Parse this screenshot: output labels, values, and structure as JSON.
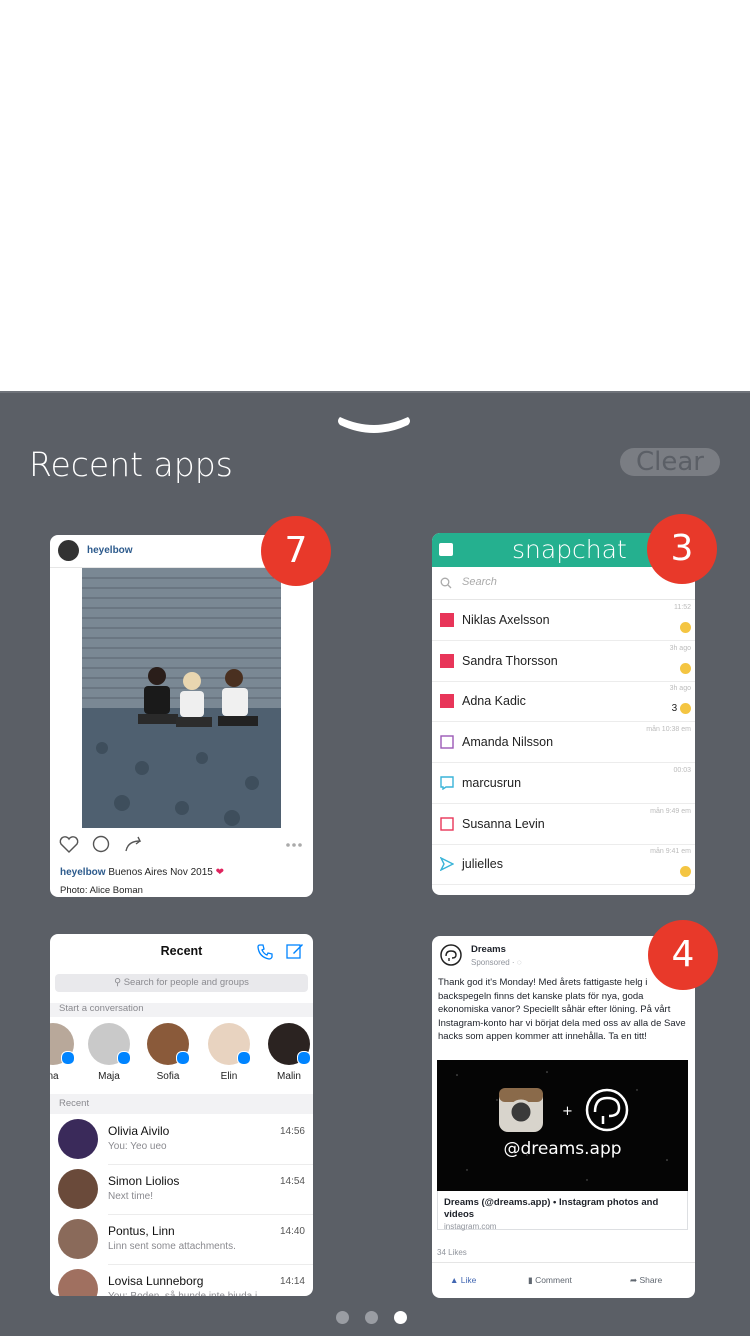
{
  "panel": {
    "title": "Recent apps",
    "clear_label": "Clear"
  },
  "instagram": {
    "badge": "7",
    "username": "heyelbow",
    "caption_user": "heyelbow",
    "caption_text": "Buenos Aires Nov 2015",
    "photo_credit": "Photo: Alice Boman"
  },
  "snapchat": {
    "badge": "3",
    "title": "snapchat",
    "search_placeholder": "Search",
    "rows": [
      {
        "name": "Niklas Axelsson",
        "time": "11:52",
        "extra": "",
        "color": "#e83559",
        "style": "filled"
      },
      {
        "name": "Sandra Thorsson",
        "time": "3h ago",
        "extra": "",
        "color": "#e83559",
        "style": "filled"
      },
      {
        "name": "Adna Kadic",
        "time": "3h ago",
        "extra": "3",
        "color": "#e83559",
        "style": "filled"
      },
      {
        "name": "Amanda Nilsson",
        "time": "mån 10:38 em",
        "extra": "",
        "color": "#9b59b6",
        "style": "outline"
      },
      {
        "name": "marcusrun",
        "time": "00:03",
        "extra": "",
        "color": "#3ab4d8",
        "style": "chat"
      },
      {
        "name": "Susanna Levin",
        "time": "mån 9:49 em",
        "extra": "",
        "color": "#e83559",
        "style": "outline"
      },
      {
        "name": "julielles",
        "time": "mån 9:41 em",
        "extra": "",
        "color": "#3ab4d8",
        "style": "arrow"
      }
    ]
  },
  "messenger": {
    "title": "Recent",
    "search_placeholder": "Search for people and groups",
    "start_label": "Start a conversation",
    "recent_label": "Recent",
    "people": [
      {
        "name": "na",
        "color": "#b8a89a"
      },
      {
        "name": "Maja",
        "color": "#c9c9c9"
      },
      {
        "name": "Sofia",
        "color": "#8a5a3a"
      },
      {
        "name": "Elin",
        "color": "#e8d3c0"
      },
      {
        "name": "Malin",
        "color": "#2b2321"
      }
    ],
    "threads": [
      {
        "name": "Olivia Aivilo",
        "sub": "You: Yeo ueo",
        "time": "14:56",
        "color": "#3a2a5a"
      },
      {
        "name": "Simon Liolios",
        "sub": "Next time!",
        "time": "14:54",
        "color": "#6a4a3a"
      },
      {
        "name": "Pontus, Linn",
        "sub": "Linn sent some attachments.",
        "time": "14:40",
        "color": "#8a6a5a"
      },
      {
        "name": "Lovisa Lunneborg",
        "sub": "You: Boden, så hunde inte bjuda i...",
        "time": "14:14",
        "color": "#a07060"
      }
    ]
  },
  "facebook": {
    "badge": "4",
    "page_name": "Dreams",
    "sponsored": "Sponsored · ",
    "post_text": "Thank god it's Monday! Med årets fattigaste helg i backspegeln finns det kanske plats för nya, goda ekonomiska vanor? Speciellt såhär efter löning. På vårt Instagram-konto har vi börjat dela med oss av alla de Save hacks som appen kommer att innehålla. Ta en titt!",
    "image_handle": "@dreams.app",
    "link_title": "Dreams (@dreams.app) • Instagram photos and videos",
    "link_url": "instagram.com",
    "likes": "34 Likes",
    "like_label": "Like",
    "comment_label": "Comment",
    "share_label": "Share"
  },
  "page_dots": {
    "count": 3,
    "active": 3
  }
}
